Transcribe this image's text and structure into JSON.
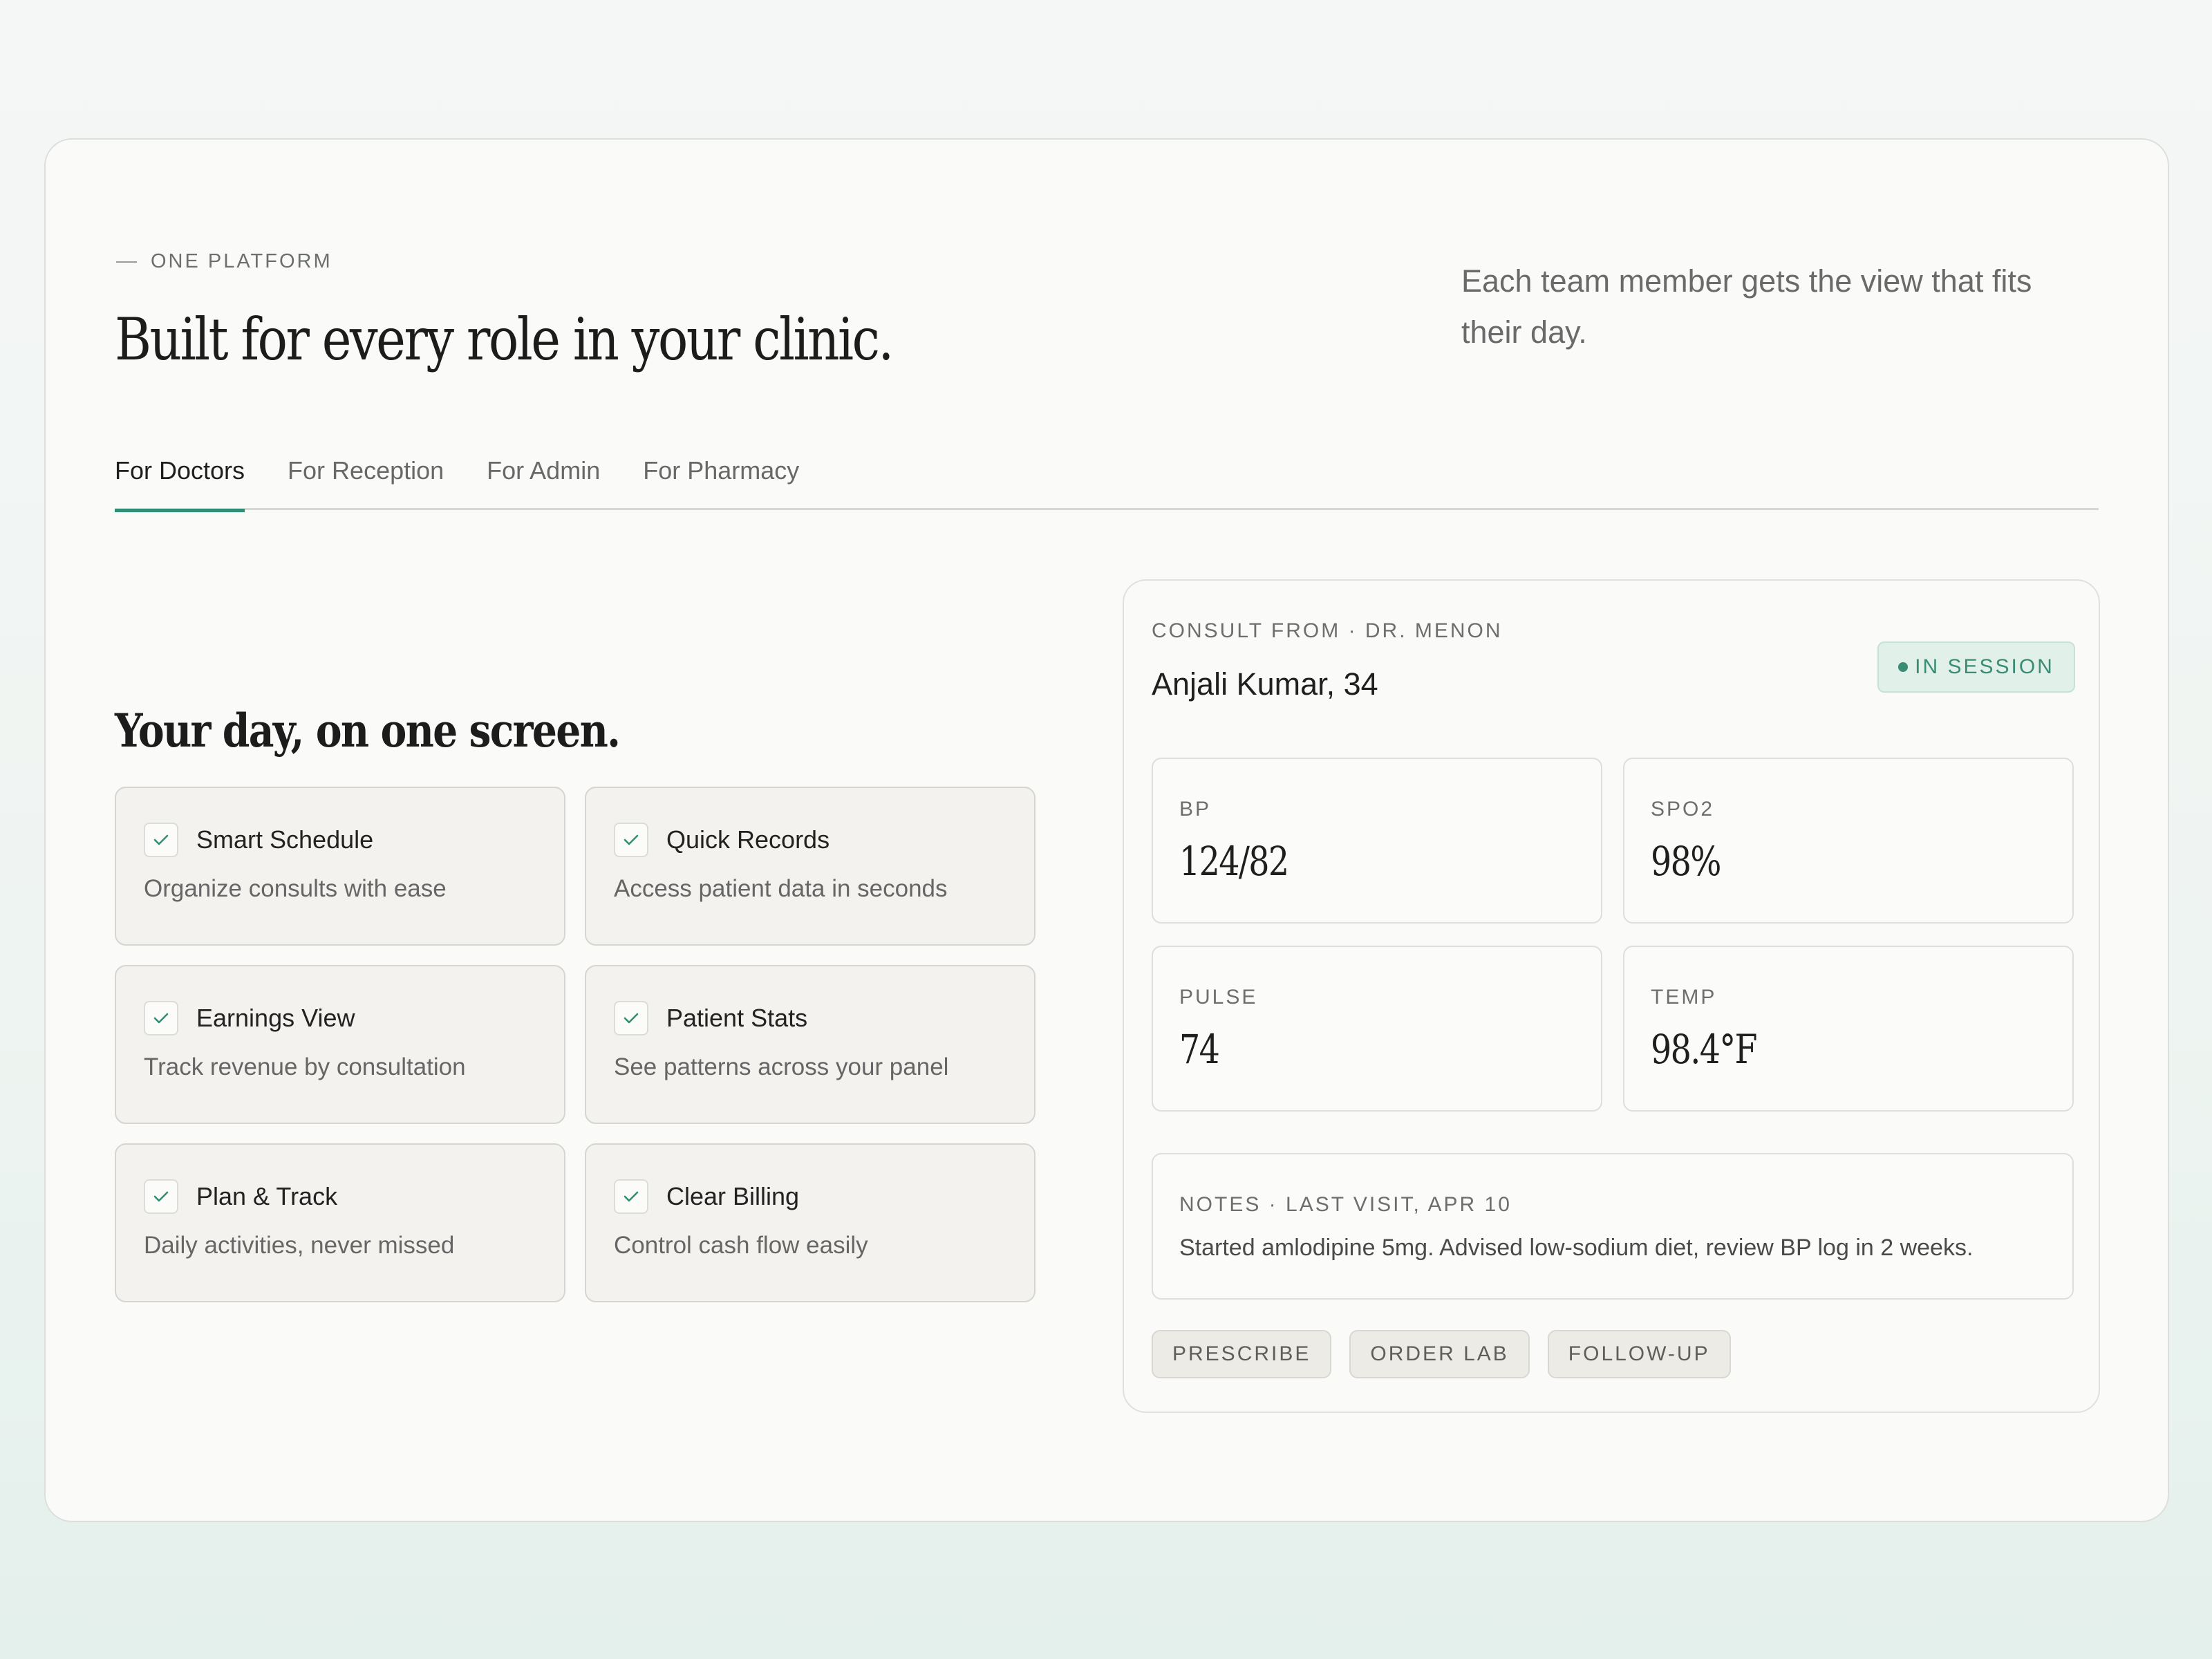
{
  "header": {
    "eyebrow": "ONE PLATFORM",
    "headline": "Built for every role in your clinic.",
    "lede": "Each team member gets the view that fits their day."
  },
  "tabs": [
    {
      "label": "For Doctors",
      "active": true
    },
    {
      "label": "For Reception",
      "active": false
    },
    {
      "label": "For Admin",
      "active": false
    },
    {
      "label": "For Pharmacy",
      "active": false
    }
  ],
  "section": {
    "title": "Your day, on one screen."
  },
  "features": [
    {
      "title": "Smart Schedule",
      "desc": "Organize consults with ease"
    },
    {
      "title": "Quick Records",
      "desc": "Access patient data in seconds"
    },
    {
      "title": "Earnings View",
      "desc": "Track revenue by consultation"
    },
    {
      "title": "Patient Stats",
      "desc": "See patterns across your panel"
    },
    {
      "title": "Plan & Track",
      "desc": "Daily activities, never missed"
    },
    {
      "title": "Clear Billing",
      "desc": "Control cash flow easily"
    }
  ],
  "consult": {
    "from_label": "CONSULT FROM · DR. MENON",
    "patient": "Anjali Kumar, 34",
    "status": "IN SESSION",
    "vitals": [
      {
        "label": "BP",
        "value": "124/82"
      },
      {
        "label": "SPO2",
        "value": "98%"
      },
      {
        "label": "PULSE",
        "value": "74"
      },
      {
        "label": "TEMP",
        "value": "98.4°F"
      }
    ],
    "notes_label": "NOTES · LAST VISIT, APR 10",
    "notes_text": "Started amlodipine 5mg. Advised low-sodium diet, review BP log in 2 weeks.",
    "actions": [
      "PRESCRIBE",
      "ORDER LAB",
      "FOLLOW-UP"
    ]
  },
  "colors": {
    "accent": "#2f8f74",
    "badge_bg": "#e2f0ea",
    "card_bg": "#fafaf8",
    "feature_bg": "#f3f2ef"
  },
  "icons": {
    "feature_check": "check-icon",
    "status": "status-dot-icon"
  }
}
